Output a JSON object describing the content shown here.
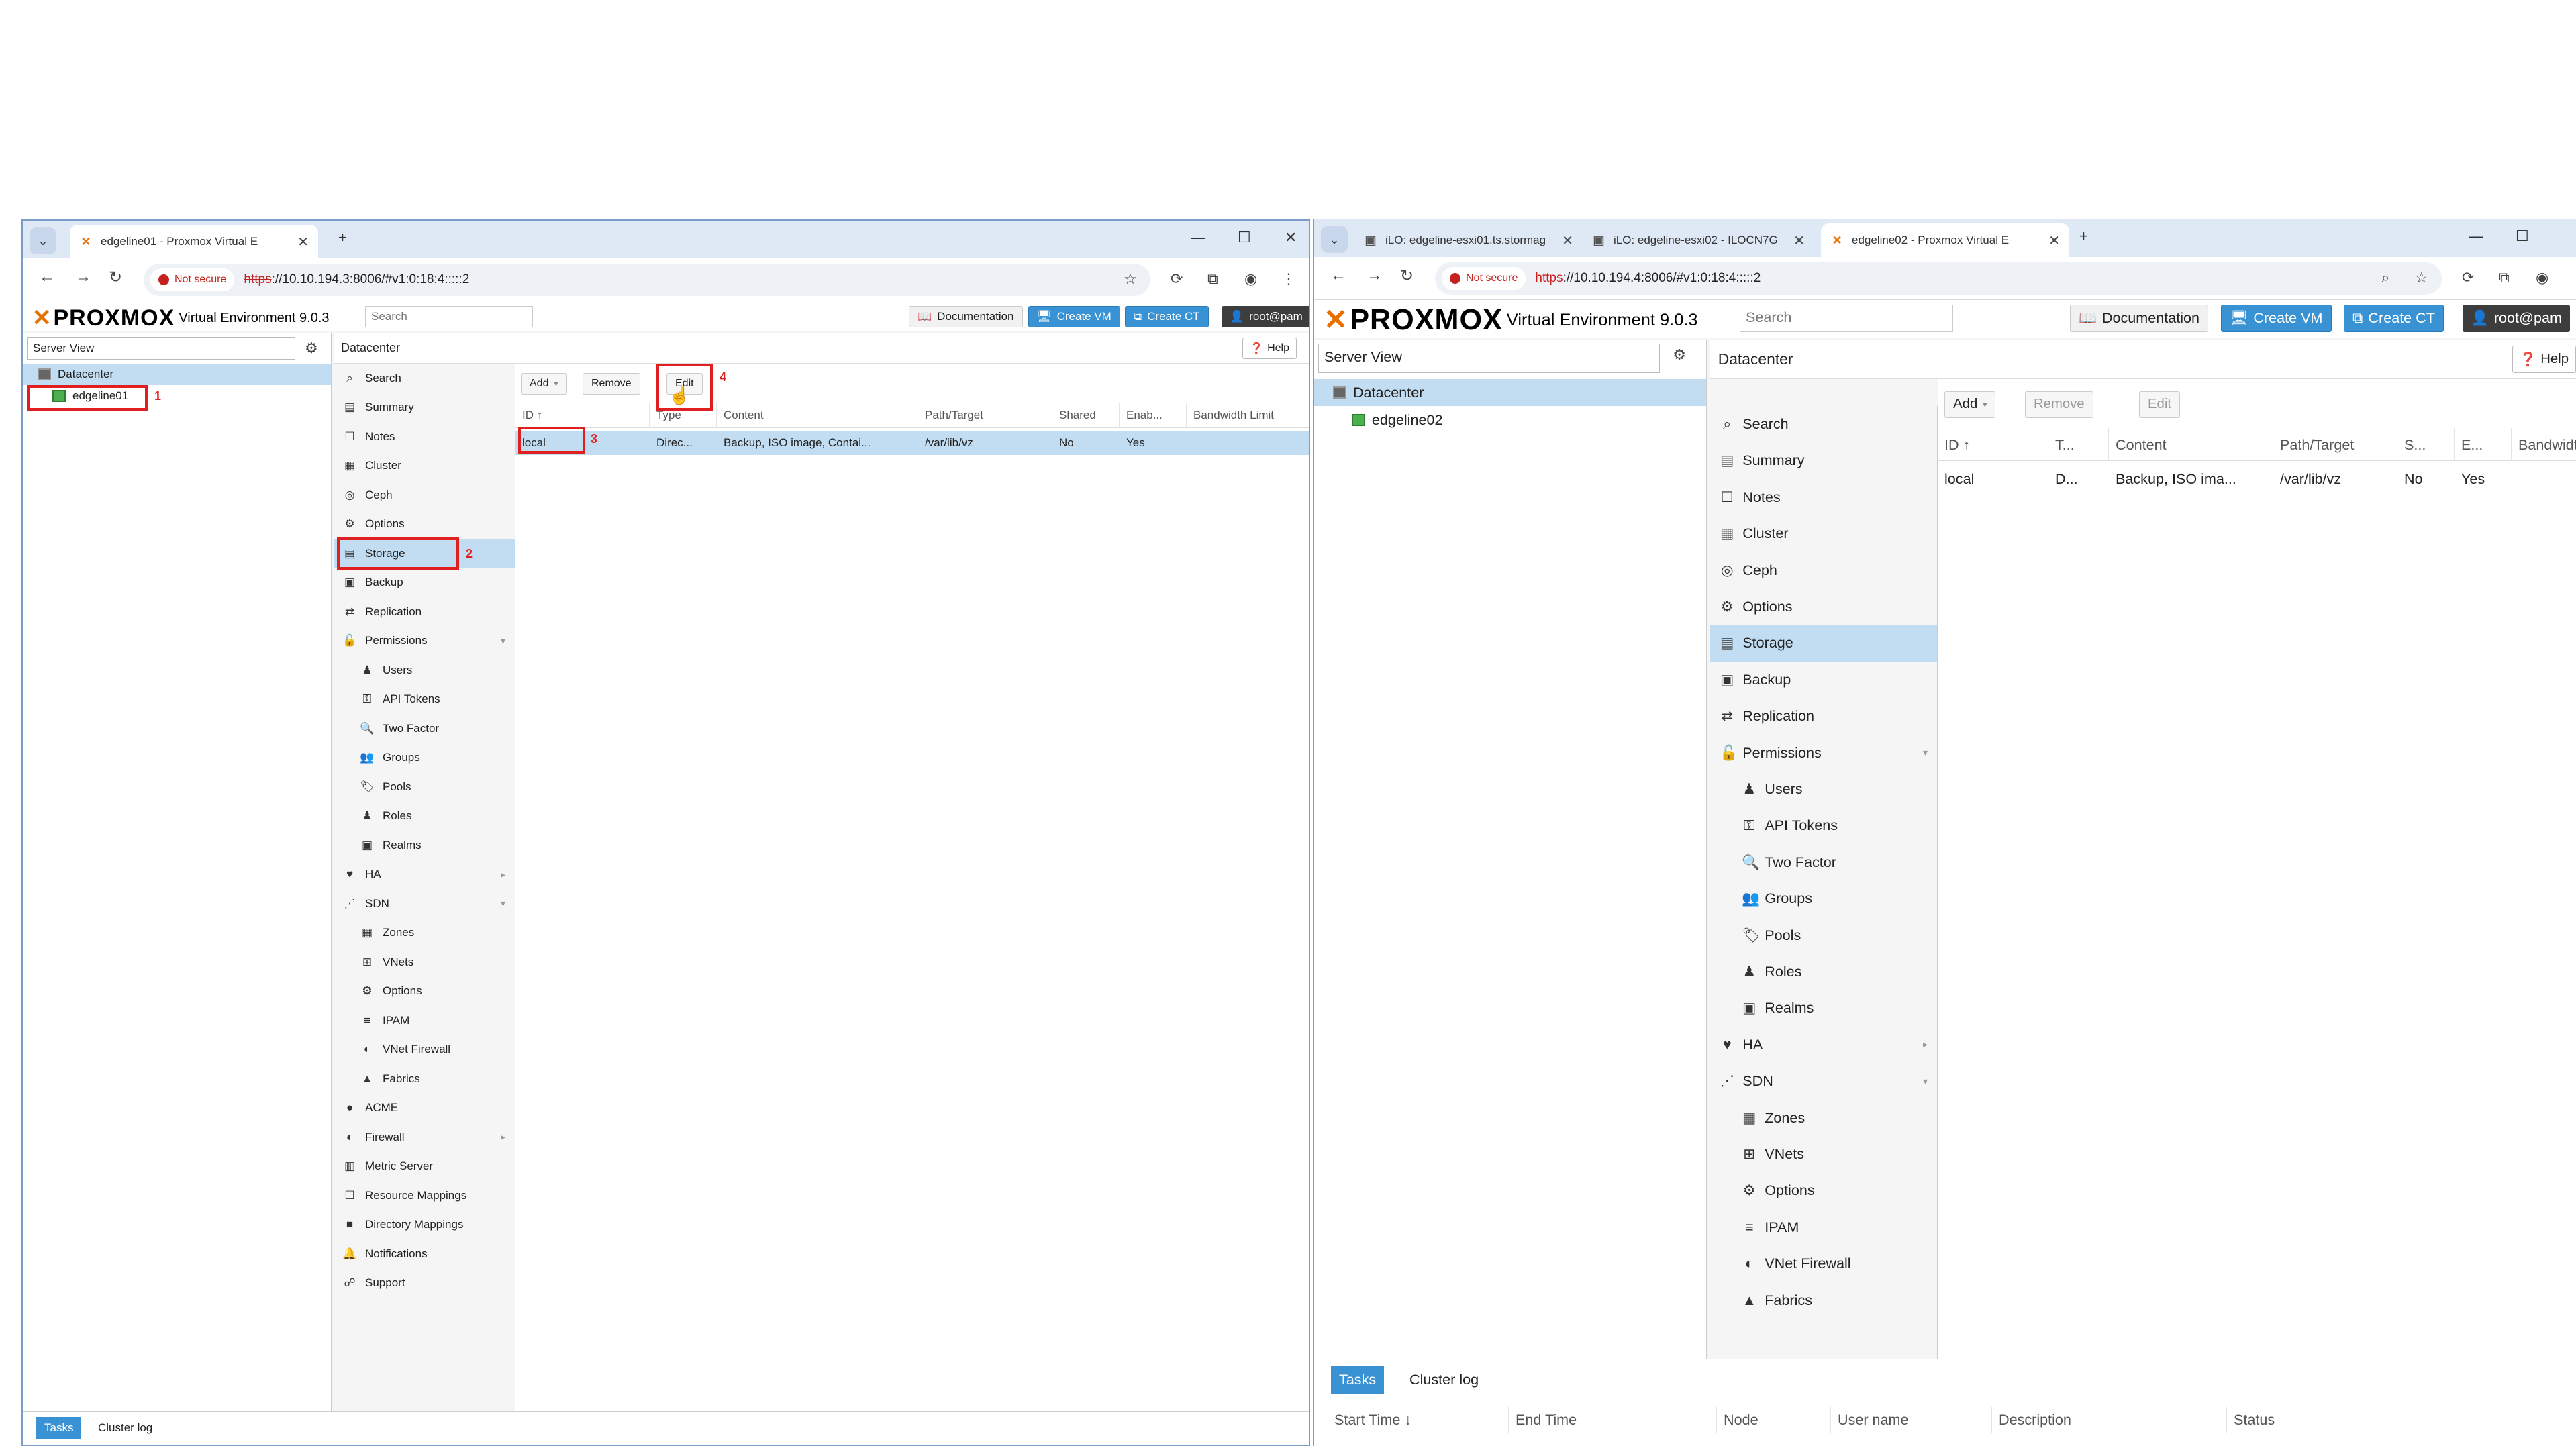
{
  "left": {
    "tabs": [
      {
        "title": "edgeline01 - Proxmox Virtual E"
      }
    ],
    "url": {
      "not_secure": "Not secure",
      "scheme": "https",
      "rest": "://10.10.194.3:8006/#v1:0:18:4:::::2"
    },
    "pve": {
      "version": "Virtual Environment 9.0.3",
      "search_placeholder": "Search",
      "doc": "Documentation",
      "create_vm": "Create VM",
      "create_ct": "Create CT",
      "user": "root@pam",
      "server_view": "Server View",
      "tree": [
        "Datacenter",
        "edgeline01"
      ],
      "breadcrumb": "Datacenter",
      "help": "Help",
      "menu": [
        "Search",
        "Summary",
        "Notes",
        "Cluster",
        "Ceph",
        "Options",
        "Storage",
        "Backup",
        "Replication",
        "Permissions",
        "Users",
        "API Tokens",
        "Two Factor",
        "Groups",
        "Pools",
        "Roles",
        "Realms",
        "HA",
        "SDN",
        "Zones",
        "VNets",
        "Options",
        "IPAM",
        "VNet Firewall",
        "Fabrics",
        "ACME",
        "Firewall",
        "Metric Server",
        "Resource Mappings",
        "Directory Mappings",
        "Notifications",
        "Support"
      ],
      "toolbar": {
        "add": "Add",
        "remove": "Remove",
        "edit": "Edit"
      },
      "columns": [
        "ID ↑",
        "Type",
        "Content",
        "Path/Target",
        "Shared",
        "Enab...",
        "Bandwidth Limit"
      ],
      "row": [
        "local",
        "Direc...",
        "Backup, ISO image, Contai...",
        "/var/lib/vz",
        "No",
        "Yes",
        ""
      ],
      "bottom_tabs": [
        "Tasks",
        "Cluster log"
      ],
      "annotations": [
        "1",
        "2",
        "3",
        "4"
      ]
    }
  },
  "right": {
    "tabs": [
      {
        "title": "iLO: edgeline-esxi01.ts.stormag"
      },
      {
        "title": "iLO: edgeline-esxi02 - ILOCN7G"
      },
      {
        "title": "edgeline02 - Proxmox Virtual E"
      }
    ],
    "url": {
      "not_secure": "Not secure",
      "scheme": "https",
      "rest": "://10.10.194.4:8006/#v1:0:18:4:::::2"
    },
    "pve": {
      "version": "Virtual Environment 9.0.3",
      "search_placeholder": "Search",
      "doc": "Documentation",
      "create_vm": "Create VM",
      "create_ct": "Create CT",
      "user": "root@pam",
      "server_view": "Server View",
      "tree": [
        "Datacenter",
        "edgeline02"
      ],
      "breadcrumb": "Datacenter",
      "help": "Help",
      "menu": [
        "Search",
        "Summary",
        "Notes",
        "Cluster",
        "Ceph",
        "Options",
        "Storage",
        "Backup",
        "Replication",
        "Permissions",
        "Users",
        "API Tokens",
        "Two Factor",
        "Groups",
        "Pools",
        "Roles",
        "Realms",
        "HA",
        "SDN",
        "Zones",
        "VNets",
        "Options",
        "IPAM",
        "VNet Firewall",
        "Fabrics"
      ],
      "toolbar": {
        "add": "Add",
        "remove": "Remove",
        "edit": "Edit"
      },
      "columns": [
        "ID ↑",
        "T...",
        "Content",
        "Path/Target",
        "S...",
        "E...",
        "Bandwidt..."
      ],
      "row": [
        "local",
        "D...",
        "Backup, ISO ima...",
        "/var/lib/vz",
        "No",
        "Yes",
        ""
      ],
      "bottom_tabs": [
        "Tasks",
        "Cluster log"
      ],
      "task_columns": [
        "Start Time ↓",
        "End Time",
        "Node",
        "User name",
        "Description",
        "Status"
      ]
    }
  },
  "colors": {
    "accent": "#3892d4",
    "selection": "#c2ddf2",
    "annotation": "#e02020",
    "brand": "#e57000"
  }
}
